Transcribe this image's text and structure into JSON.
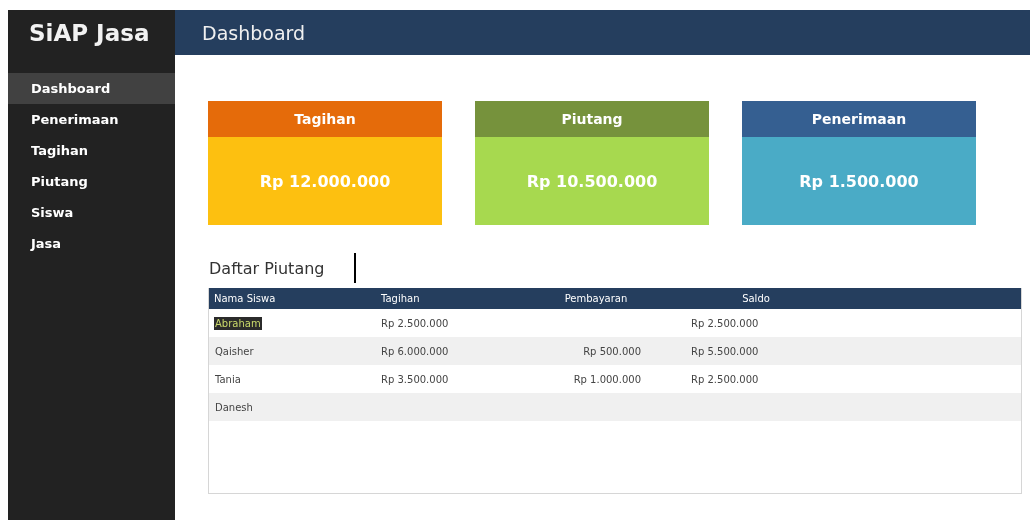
{
  "sidebar": {
    "brand": "SiAP Jasa",
    "items": [
      {
        "label": "Dashboard",
        "selected": true
      },
      {
        "label": "Penerimaan",
        "selected": false
      },
      {
        "label": "Tagihan",
        "selected": false
      },
      {
        "label": "Piutang",
        "selected": false
      },
      {
        "label": "Siswa",
        "selected": false
      },
      {
        "label": "Jasa",
        "selected": false
      }
    ]
  },
  "header": {
    "title": "Dashboard"
  },
  "cards": [
    {
      "title": "Tagihan",
      "color": "#e56b0a",
      "body": {
        "value": "Rp 12.000.000",
        "color": "#fdc010"
      }
    },
    {
      "title": "Piutang",
      "color": "#76923c",
      "body": {
        "value": "Rp 10.500.000",
        "color": "#a7d94f"
      }
    },
    {
      "title": "Penerimaan",
      "color": "#355f91",
      "body": {
        "value": "Rp 1.500.000",
        "color": "#4aabc6"
      }
    }
  ],
  "table": {
    "title": "Daftar Piutang",
    "columns": [
      "Nama Siswa",
      "Tagihan",
      "Pembayaran",
      "Saldo"
    ],
    "rows": [
      {
        "cells": [
          "Abraham",
          "Rp 2.500.000",
          "",
          "Rp 2.500.000"
        ],
        "selected": true
      },
      {
        "cells": [
          "Qaisher",
          "Rp 6.000.000",
          "Rp 500.000",
          "Rp 5.500.000"
        ],
        "selected": false
      },
      {
        "cells": [
          "Tania",
          "Rp 3.500.000",
          "Rp 1.000.000",
          "Rp 2.500.000"
        ],
        "selected": false
      },
      {
        "cells": [
          "Danesh",
          "",
          "",
          ""
        ],
        "selected": false
      }
    ]
  }
}
